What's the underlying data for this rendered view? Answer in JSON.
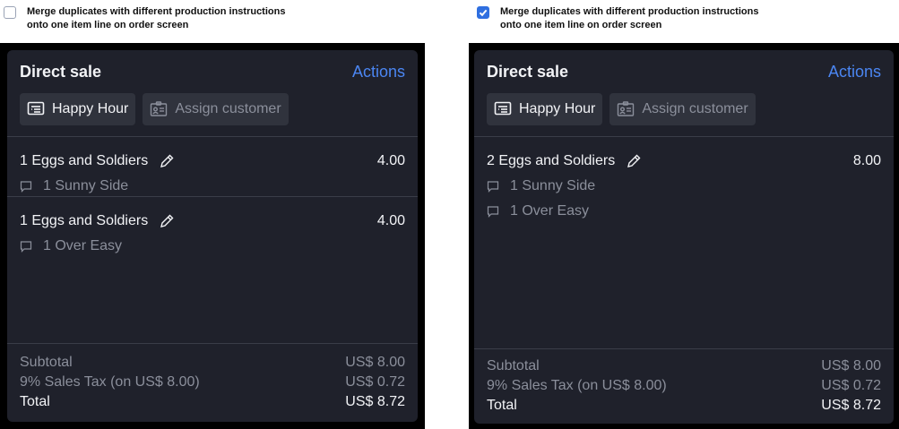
{
  "left": {
    "setting": {
      "checked": false,
      "label": "Merge duplicates with different production instructions onto one item line on order screen"
    },
    "card": {
      "title": "Direct sale",
      "actions_label": "Actions",
      "chips": {
        "happy_hour": "Happy Hour",
        "assign_customer": "Assign customer"
      },
      "items": [
        {
          "name": "1 Eggs and Soldiers",
          "price": "4.00",
          "modifiers": [
            "1 Sunny Side"
          ]
        },
        {
          "name": "1 Eggs and Soldiers",
          "price": "4.00",
          "modifiers": [
            "1 Over Easy"
          ]
        }
      ],
      "totals": {
        "subtotal_label": "Subtotal",
        "subtotal_value": "US$ 8.00",
        "tax_label": "9% Sales Tax (on US$ 8.00)",
        "tax_value": "US$ 0.72",
        "total_label": "Total",
        "total_value": "US$ 8.72"
      }
    }
  },
  "right": {
    "setting": {
      "checked": true,
      "label": "Merge duplicates with different production instructions onto one item line on order screen"
    },
    "card": {
      "title": "Direct sale",
      "actions_label": "Actions",
      "chips": {
        "happy_hour": "Happy Hour",
        "assign_customer": "Assign customer"
      },
      "items": [
        {
          "name": "2 Eggs and Soldiers",
          "price": "8.00",
          "modifiers": [
            "1 Sunny Side",
            "1 Over Easy"
          ]
        }
      ],
      "totals": {
        "subtotal_label": "Subtotal",
        "subtotal_value": "US$ 8.00",
        "tax_label": "9% Sales Tax (on US$ 8.00)",
        "tax_value": "US$ 0.72",
        "total_label": "Total",
        "total_value": "US$ 8.72"
      }
    }
  },
  "colors": {
    "accent": "#4b86f2",
    "card_bg": "#1f212b",
    "chip_bg": "#30333d",
    "checkbox_checked": "#2f6fe0"
  },
  "icons": {
    "happy_hour": "menu-card-icon",
    "assign_customer": "contact-card-icon",
    "edit": "pencil-icon",
    "note": "comment-icon",
    "checkbox": "checkmark-icon"
  }
}
